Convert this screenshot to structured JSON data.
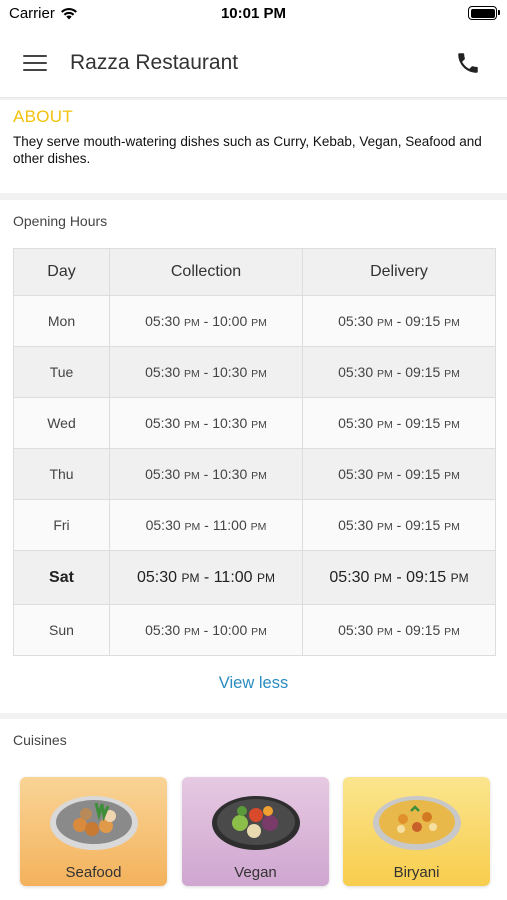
{
  "status_bar": {
    "carrier": "Carrier",
    "time": "10:01 PM"
  },
  "nav": {
    "title": "Razza Restaurant",
    "menu_icon": "hamburger-menu-icon",
    "phone_icon": "phone-icon"
  },
  "about": {
    "heading": "ABOUT",
    "text": "They serve mouth-watering dishes such as Curry, Kebab, Vegan, Seafood and other dishes."
  },
  "opening_hours": {
    "heading": "Opening Hours",
    "columns": [
      "Day",
      "Collection",
      "Delivery"
    ],
    "rows": [
      {
        "day": "Mon",
        "col_start": "05:30",
        "col_start_ampm": "PM",
        "col_end": "10:00",
        "col_end_ampm": "PM",
        "del_start": "05:30",
        "del_start_ampm": "PM",
        "del_end": "09:15",
        "del_end_ampm": "PM"
      },
      {
        "day": "Tue",
        "col_start": "05:30",
        "col_start_ampm": "PM",
        "col_end": "10:30",
        "col_end_ampm": "PM",
        "del_start": "05:30",
        "del_start_ampm": "PM",
        "del_end": "09:15",
        "del_end_ampm": "PM"
      },
      {
        "day": "Wed",
        "col_start": "05:30",
        "col_start_ampm": "PM",
        "col_end": "10:30",
        "col_end_ampm": "PM",
        "del_start": "05:30",
        "del_start_ampm": "PM",
        "del_end": "09:15",
        "del_end_ampm": "PM"
      },
      {
        "day": "Thu",
        "col_start": "05:30",
        "col_start_ampm": "PM",
        "col_end": "10:30",
        "col_end_ampm": "PM",
        "del_start": "05:30",
        "del_start_ampm": "PM",
        "del_end": "09:15",
        "del_end_ampm": "PM"
      },
      {
        "day": "Fri",
        "col_start": "05:30",
        "col_start_ampm": "PM",
        "col_end": "11:00",
        "col_end_ampm": "PM",
        "del_start": "05:30",
        "del_start_ampm": "PM",
        "del_end": "09:15",
        "del_end_ampm": "PM"
      },
      {
        "day": "Sat",
        "col_start": "05:30",
        "col_start_ampm": "PM",
        "col_end": "11:00",
        "col_end_ampm": "PM",
        "del_start": "05:30",
        "del_start_ampm": "PM",
        "del_end": "09:15",
        "del_end_ampm": "PM"
      },
      {
        "day": "Sun",
        "col_start": "05:30",
        "col_start_ampm": "PM",
        "col_end": "10:00",
        "col_end_ampm": "PM",
        "del_start": "05:30",
        "del_start_ampm": "PM",
        "del_end": "09:15",
        "del_end_ampm": "PM"
      }
    ],
    "highlighted_day": "Sat",
    "view_less_label": "View less"
  },
  "cuisines": {
    "heading": "Cuisines",
    "items": [
      {
        "label": "Seafood",
        "icon": "seafood-dish-icon"
      },
      {
        "label": "Vegan",
        "icon": "vegan-dish-icon"
      },
      {
        "label": "Biryani",
        "icon": "biryani-dish-icon"
      }
    ]
  },
  "colors": {
    "about_heading": "#f2c20c",
    "link": "#2a8dc2"
  }
}
